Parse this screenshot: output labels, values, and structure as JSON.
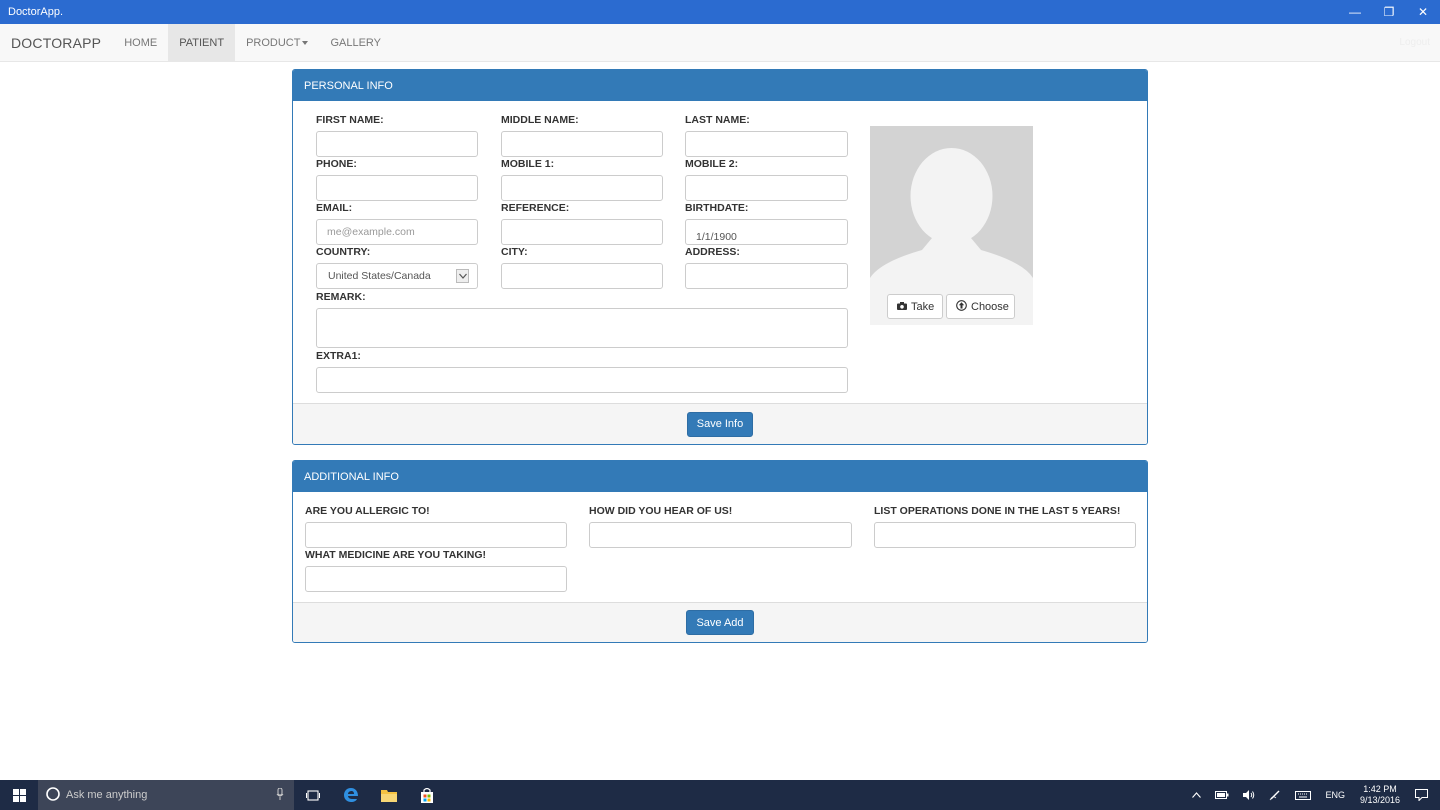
{
  "window": {
    "title": "DoctorApp."
  },
  "navbar": {
    "brand": "DOCTORAPP",
    "items": [
      {
        "label": "HOME"
      },
      {
        "label": "PATIENT",
        "active": true
      },
      {
        "label": "PRODUCT"
      },
      {
        "label": "GALLERY"
      }
    ],
    "right_text": "Logout"
  },
  "personal_info": {
    "heading": "PERSONAL INFO",
    "fields": {
      "first_name": {
        "label": "FIRST NAME:",
        "value": ""
      },
      "middle_name": {
        "label": "MIDDLE NAME:",
        "value": ""
      },
      "last_name": {
        "label": "LAST NAME:",
        "value": ""
      },
      "phone": {
        "label": "PHONE:",
        "value": ""
      },
      "mobile1": {
        "label": "MOBILE 1:",
        "value": ""
      },
      "mobile2": {
        "label": "MOBILE 2:",
        "value": ""
      },
      "email": {
        "label": "EMAIL:",
        "placeholder": "me@example.com"
      },
      "reference": {
        "label": "REFERENCE:",
        "value": ""
      },
      "birthdate": {
        "label": "BIRTHDATE:",
        "value": "1/1/1900"
      },
      "country": {
        "label": "COUNTRY:",
        "value": "United States/Canada"
      },
      "city": {
        "label": "CITY:",
        "value": ""
      },
      "address": {
        "label": "ADDRESS:",
        "value": ""
      },
      "remark": {
        "label": "REMARK:",
        "value": ""
      },
      "extra1": {
        "label": "EXTRA1:",
        "value": ""
      }
    },
    "photo": {
      "take_label": "Take",
      "choose_label": "Choose"
    },
    "save_label": "Save Info"
  },
  "additional_info": {
    "heading": "ADDITIONAL INFO",
    "fields": {
      "allergic": {
        "label": "ARE YOU ALLERGIC TO!",
        "value": ""
      },
      "hear": {
        "label": "HOW DID YOU HEAR OF US!",
        "value": ""
      },
      "operations": {
        "label": "LIST OPERATIONS DONE IN THE LAST 5 YEARS!",
        "value": ""
      },
      "medicine": {
        "label": "WHAT MEDICINE ARE YOU TAKING!",
        "value": ""
      }
    },
    "save_label": "Save Add"
  },
  "taskbar": {
    "search_placeholder": "Ask me anything",
    "language": "ENG",
    "time": "1:42 PM",
    "date": "9/13/2016"
  },
  "colors": {
    "primary": "#337ab7",
    "titlebar": "#2b6bd0",
    "taskbar": "#1e2b45"
  }
}
